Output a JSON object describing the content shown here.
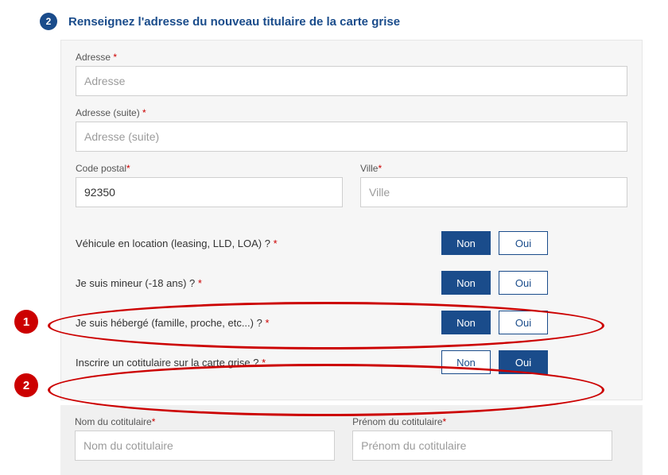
{
  "header": {
    "step_number": "2",
    "title": "Renseignez l'adresse du nouveau titulaire de la carte grise"
  },
  "form": {
    "address": {
      "label": "Adresse",
      "placeholder": "Adresse",
      "value": "",
      "required_mark": "*"
    },
    "address2": {
      "label": "Adresse (suite)",
      "placeholder": "Adresse (suite)",
      "value": "",
      "required_mark": "*"
    },
    "postal": {
      "label": "Code postal",
      "value": "92350",
      "required_mark": "*"
    },
    "city": {
      "label": "Ville",
      "placeholder": "Ville",
      "value": "",
      "required_mark": "*"
    }
  },
  "questions": {
    "leasing": {
      "label": "Véhicule en location (leasing, LLD, LOA) ?",
      "required_mark": "*",
      "no": "Non",
      "yes": "Oui",
      "selected": "no"
    },
    "minor": {
      "label": "Je suis mineur (-18 ans) ?",
      "required_mark": "*",
      "no": "Non",
      "yes": "Oui",
      "selected": "no"
    },
    "hosted": {
      "label": "Je suis hébergé (famille, proche, etc...) ?",
      "required_mark": "*",
      "no": "Non",
      "yes": "Oui",
      "selected": "no"
    },
    "coholder": {
      "label": "Inscrire un cotitulaire sur la carte grise ?",
      "required_mark": "*",
      "no": "Non",
      "yes": "Oui",
      "selected": "yes"
    }
  },
  "coholder_fields": {
    "lastname": {
      "label": "Nom du cotitulaire",
      "placeholder": "Nom du cotitulaire",
      "required_mark": "*"
    },
    "firstname": {
      "label": "Prénom du cotitulaire",
      "placeholder": "Prénom du cotitulaire",
      "required_mark": "*"
    }
  },
  "annotations": {
    "marker1": "1",
    "marker2": "2"
  }
}
